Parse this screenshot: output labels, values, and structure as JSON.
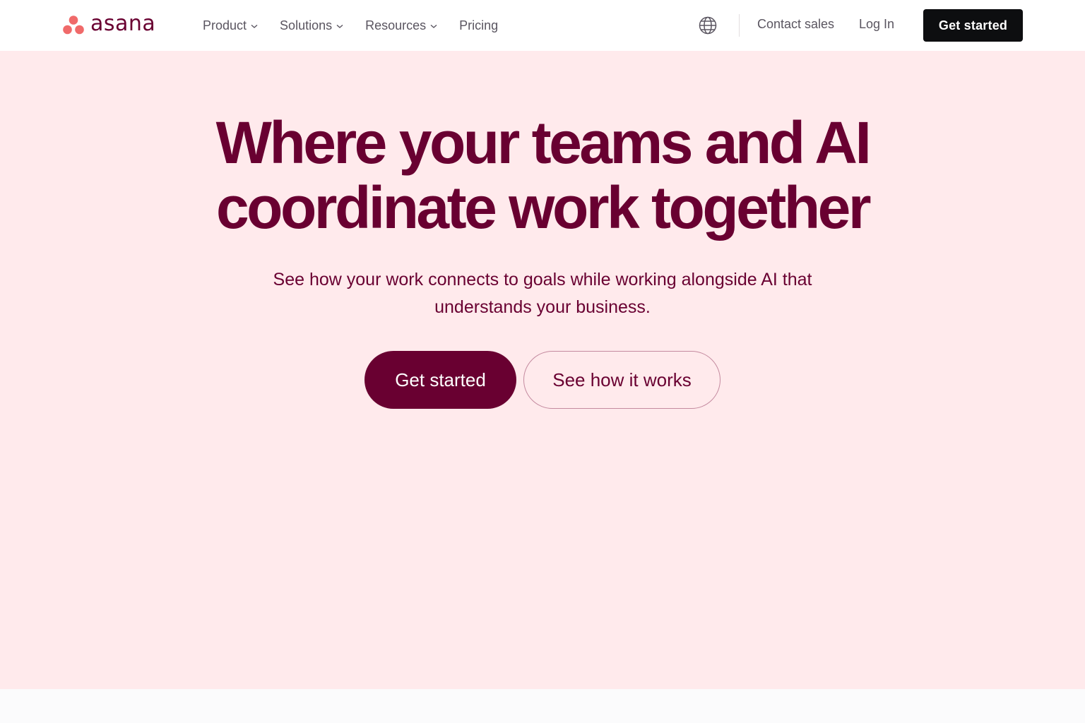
{
  "header": {
    "brand": "asana",
    "nav": [
      {
        "label": "Product",
        "dropdown": true
      },
      {
        "label": "Solutions",
        "dropdown": true
      },
      {
        "label": "Resources",
        "dropdown": true
      },
      {
        "label": "Pricing",
        "dropdown": false
      }
    ],
    "language_icon": "globe-icon",
    "contact_label": "Contact sales",
    "login_label": "Log In",
    "cta_label": "Get started"
  },
  "hero": {
    "headline_line1": "Where your teams and AI",
    "headline_line2": "coordinate work together",
    "subhead_line1": "See how your work connects to goals while working alongside AI that",
    "subhead_line2": "understands your business.",
    "primary_cta": "Get started",
    "secondary_cta": "See how it works"
  },
  "colors": {
    "brand_plum": "#690031",
    "hero_background": "#ffeaec",
    "logo_coral": "#f06a6a",
    "header_cta_background": "#0d0e10"
  }
}
